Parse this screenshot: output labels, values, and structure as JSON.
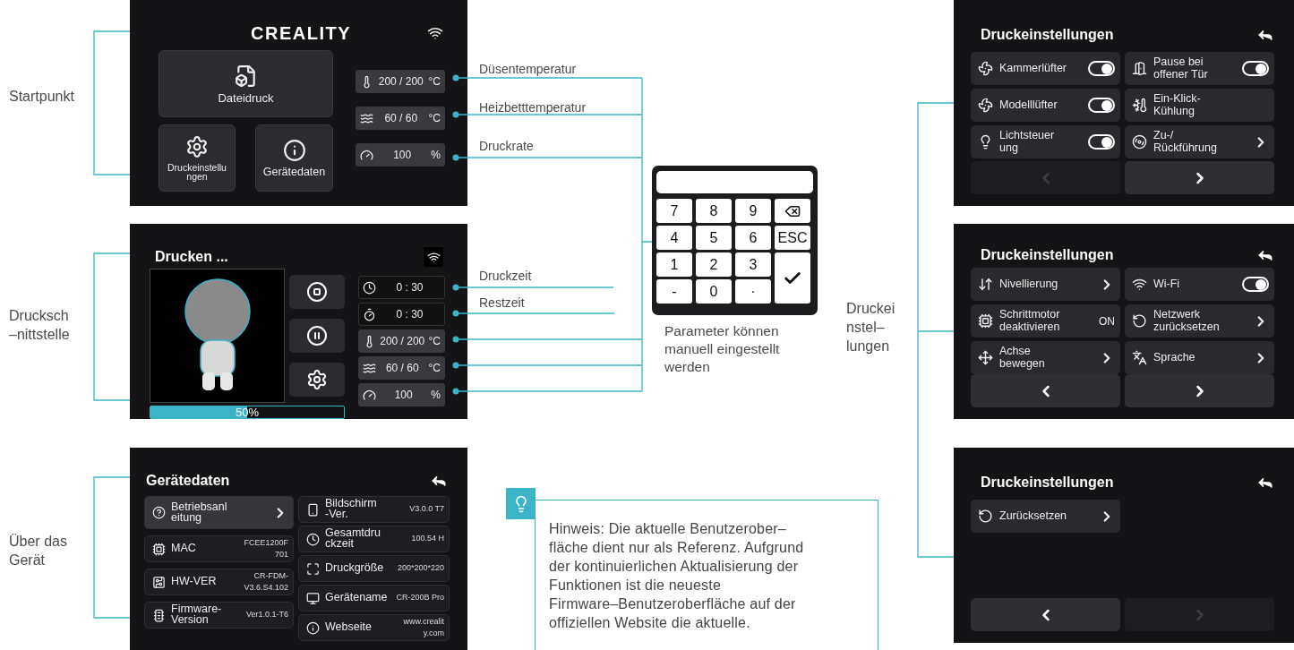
{
  "annotations": {
    "left_labels": [
      "Startpunkt",
      "Drucksch\n–nittstelle",
      "Über das\nGerät"
    ],
    "right_label": "Druckei\nnstel–\nlungen",
    "callouts": [
      "Düsentemperatur",
      "Heizbetttemperatur",
      "Druckrate",
      "Druckzeit",
      "Restzeit"
    ],
    "keypad_caption": "Parameter können\nmanuell eingestellt\nwerden",
    "tip": "Hinweis: Die aktuelle Benutzerober–\nfläche dient nur als Referenz. Aufgrund\nder kontinuierlichen Aktualisierung der\nFunktionen ist die neueste\nFirmware–Benutzeroberfläche auf der\noffiziellen Website die aktuelle."
  },
  "home_screen": {
    "logo": "CREALITY",
    "tiles": [
      {
        "label": "Dateidruck"
      },
      {
        "label": "Druckeinstellu\nngen"
      },
      {
        "label": "Gerätedaten"
      }
    ],
    "readouts": [
      {
        "kind": "nozzle",
        "value": "200 / 200",
        "unit": "°C"
      },
      {
        "kind": "bed",
        "value": "60 / 60",
        "unit": "°C"
      },
      {
        "kind": "speed",
        "value": "100",
        "unit": "%"
      }
    ]
  },
  "print_screen": {
    "title": "Drucken ...",
    "buttons": [
      {
        "kind": "stop"
      },
      {
        "kind": "pause"
      },
      {
        "kind": "settings"
      }
    ],
    "progress": {
      "level": 0.5,
      "label": "50%"
    },
    "readouts": [
      {
        "kind": "time",
        "value": "0 : 30"
      },
      {
        "kind": "remaining",
        "value": "0 : 30"
      },
      {
        "kind": "nozzle",
        "value": "200 / 200",
        "unit": "°C"
      },
      {
        "kind": "bed",
        "value": "60 / 60",
        "unit": "°C"
      },
      {
        "kind": "speed",
        "value": "100",
        "unit": "%"
      }
    ]
  },
  "device_screen": {
    "title": "Gerätedaten",
    "left": [
      {
        "kind": "link",
        "label": "Betriebsanl\neitung"
      },
      {
        "kind": "info",
        "label": "MAC",
        "value": "FCEE1200F\n701"
      },
      {
        "kind": "info",
        "label": "HW-VER",
        "value": "CR-FDM-\nV3.6.S4.102"
      },
      {
        "kind": "info",
        "label": "Firmware-\nVersion",
        "value": "Ver1.0.1-T6"
      }
    ],
    "right": [
      {
        "kind": "info",
        "label": "Bildschirm\n-Ver.",
        "value": "V3.0.0 T7"
      },
      {
        "kind": "info",
        "label": "Gesamtdru\nckzeit",
        "value": "100.54 H"
      },
      {
        "kind": "info",
        "label": "Druckgröße",
        "value": "200*200*220"
      },
      {
        "kind": "info",
        "label": "Gerätename",
        "value": "CR-200B Pro"
      },
      {
        "kind": "info",
        "label": "Webseite",
        "value": "www.crealit\ny.com"
      }
    ]
  },
  "keypad": {
    "keys": [
      {
        "kind": "digit",
        "label": "7"
      },
      {
        "kind": "digit",
        "label": "8"
      },
      {
        "kind": "digit",
        "label": "9"
      },
      {
        "kind": "backspace"
      },
      {
        "kind": "digit",
        "label": "4"
      },
      {
        "kind": "digit",
        "label": "5"
      },
      {
        "kind": "digit",
        "label": "6"
      },
      {
        "kind": "digit",
        "label": "ESC"
      },
      {
        "kind": "digit",
        "label": "1"
      },
      {
        "kind": "digit",
        "label": "2"
      },
      {
        "kind": "digit",
        "label": "3"
      },
      {
        "kind": "confirm"
      },
      {
        "kind": "digit",
        "label": "-"
      },
      {
        "kind": "digit",
        "label": "0"
      },
      {
        "kind": "digit",
        "label": "·"
      }
    ]
  },
  "settings_pages": [
    {
      "title": "Druckeinstellungen",
      "items": [
        {
          "kind": "toggle",
          "label": "Kammerlüfter",
          "on": true
        },
        {
          "kind": "toggle",
          "label": "Pause bei\noffener Tür",
          "on": true
        },
        {
          "kind": "toggle",
          "label": "Modelllüfter",
          "on": true
        },
        {
          "kind": "plain",
          "label": "Ein-Klick-\nKühlung"
        },
        {
          "kind": "toggle",
          "label": "Lichtsteuer\nung",
          "on": true
        },
        {
          "kind": "link",
          "label": "Zu-/\nRückführung"
        }
      ],
      "nav": [
        {
          "disabled": true
        },
        {
          "disabled": false
        }
      ]
    },
    {
      "title": "Druckeinstellungen",
      "items": [
        {
          "kind": "link",
          "label": "Nivellierung"
        },
        {
          "kind": "toggle",
          "label": "Wi-Fi",
          "on": true
        },
        {
          "kind": "value",
          "label": "Schrittmotor\ndeaktivieren",
          "value": "ON"
        },
        {
          "kind": "link",
          "label": "Netzwerk\nzurücksetzen"
        },
        {
          "kind": "link",
          "label": "Achse\nbewegen"
        },
        {
          "kind": "link",
          "label": "Sprache"
        }
      ],
      "nav": [
        {
          "disabled": false
        },
        {
          "disabled": false
        }
      ]
    },
    {
      "title": "Druckeinstellungen",
      "items": [
        {
          "kind": "link",
          "label": "Zurücksetzen"
        }
      ],
      "nav": [
        {
          "disabled": false
        },
        {
          "disabled": true
        }
      ]
    }
  ]
}
